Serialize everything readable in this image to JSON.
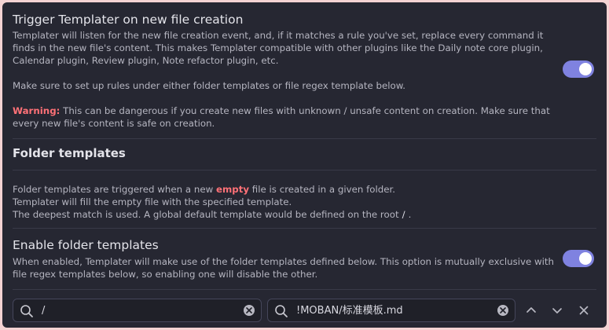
{
  "trigger": {
    "title": "Trigger Templater on new file creation",
    "desc1": "Templater will listen for the new file creation event, and, if it matches a rule you've set, replace every command it finds in the new file's content. This makes Templater compatible with other plugins like the Daily note core plugin, Calendar plugin, Review plugin, Note refactor plugin, etc.",
    "desc2": "Make sure to set up rules under either folder templates or file regex template below.",
    "warning_label": "Warning:",
    "warning_text": " This can be dangerous if you create new files with unknown / unsafe content on creation. Make sure that every new file's content is safe on creation.",
    "enabled": true
  },
  "folder_templates": {
    "heading": "Folder templates",
    "line1_pre": "Folder templates are triggered when a new ",
    "line1_emph": "empty",
    "line1_post": " file is created in a given folder.",
    "line2": "Templater will fill the empty file with the specified template.",
    "line3_pre": "The deepest match is used. A global default template would be defined on the root",
    "line3_code": "/",
    "line3_post": "."
  },
  "enable_folder": {
    "title": "Enable folder templates",
    "desc": "When enabled, Templater will make use of the folder templates defined below. This option is mutually exclusive with file regex templates below, so enabling one will disable the other.",
    "enabled": true
  },
  "rule": {
    "folder_value": "/",
    "template_value": "!MOBAN/标准模板.md"
  },
  "colors": {
    "accent": "#7f82e0",
    "warning": "#ff7177",
    "background": "#262732"
  },
  "icons": [
    "search-icon",
    "clear-icon",
    "chevron-up-icon",
    "chevron-down-icon",
    "close-icon"
  ]
}
